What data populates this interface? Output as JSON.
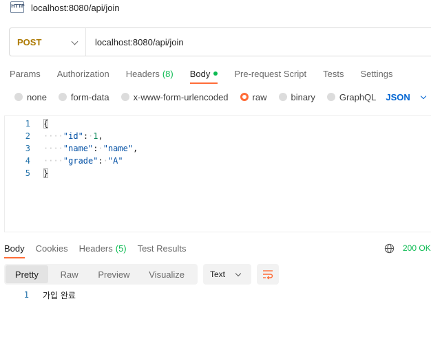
{
  "titlebar": {
    "icon": "http-file-icon",
    "icon_text": "HTTP",
    "title": "localhost:8080/api/join"
  },
  "request": {
    "method": "POST",
    "method_color": "#ad7a03",
    "url": "localhost:8080/api/join"
  },
  "request_tabs": [
    {
      "label": "Params"
    },
    {
      "label": "Authorization"
    },
    {
      "label": "Headers",
      "count": "(8)"
    },
    {
      "label": "Body",
      "active": true,
      "indicator": "green-dot"
    },
    {
      "label": "Pre-request Script"
    },
    {
      "label": "Tests"
    },
    {
      "label": "Settings"
    }
  ],
  "body_types": {
    "options": [
      "none",
      "form-data",
      "x-www-form-urlencoded",
      "raw",
      "binary",
      "GraphQL"
    ],
    "selected": "raw",
    "language": "JSON"
  },
  "editor": {
    "lines": [
      {
        "num": "1",
        "text": "{"
      },
      {
        "num": "2",
        "key": "\"id\"",
        "value": "1",
        "trailing": ","
      },
      {
        "num": "3",
        "key": "\"name\"",
        "value": "\"name\"",
        "trailing": ","
      },
      {
        "num": "4",
        "key": "\"grade\"",
        "value": "\"A\"",
        "trailing": ""
      },
      {
        "num": "5",
        "text": "}"
      }
    ]
  },
  "response_tabs": [
    {
      "label": "Body",
      "active": true
    },
    {
      "label": "Cookies"
    },
    {
      "label": "Headers",
      "count": "(5)"
    },
    {
      "label": "Test Results"
    }
  ],
  "status": {
    "icon": "globe-icon",
    "text": "200 OK"
  },
  "view_modes": [
    "Pretty",
    "Raw",
    "Preview",
    "Visualize"
  ],
  "active_view_mode": "Pretty",
  "format": "Text",
  "wrap_icon": "wrap-lines-icon",
  "response_body": {
    "num": "1",
    "text": "가입 완료"
  },
  "colors": {
    "accent": "#ff6c37",
    "success": "#0cbb52",
    "link": "#0265d2"
  }
}
